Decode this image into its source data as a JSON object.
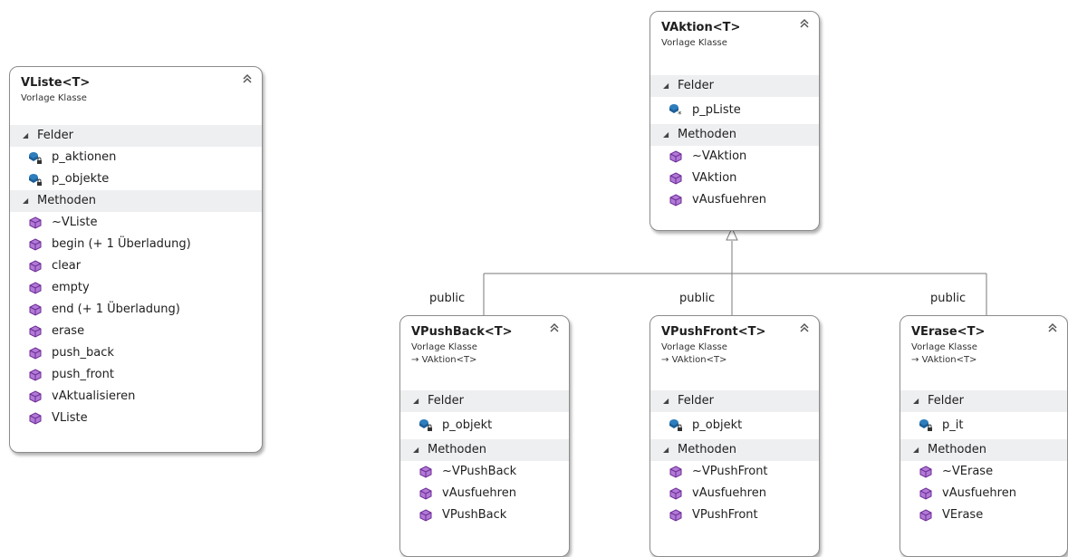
{
  "diagram": {
    "classes": {
      "vliste": {
        "title": "VListe<T>",
        "stereotype": "Vorlage Klasse",
        "fields_header": "Felder",
        "fields": [
          "p_aktionen",
          "p_objekte"
        ],
        "methods_header": "Methoden",
        "methods": [
          "~VListe",
          "begin (+ 1 Überladung)",
          "clear",
          "empty",
          "end (+ 1 Überladung)",
          "erase",
          "push_back",
          "push_front",
          "vAktualisieren",
          "VListe"
        ]
      },
      "vaktion": {
        "title": "VAktion<T>",
        "stereotype": "Vorlage Klasse",
        "fields_header": "Felder",
        "fields": [
          "p_pListe"
        ],
        "methods_header": "Methoden",
        "methods": [
          "~VAktion",
          "VAktion",
          "vAusfuehren"
        ]
      },
      "vpushback": {
        "title": "VPushBack<T>",
        "stereotype": "Vorlage Klasse",
        "inherits": "VAktion<T>",
        "fields_header": "Felder",
        "fields": [
          "p_objekt"
        ],
        "methods_header": "Methoden",
        "methods": [
          "~VPushBack",
          "vAusfuehren",
          "VPushBack"
        ]
      },
      "vpushfront": {
        "title": "VPushFront<T>",
        "stereotype": "Vorlage Klasse",
        "inherits": "VAktion<T>",
        "fields_header": "Felder",
        "fields": [
          "p_objekt"
        ],
        "methods_header": "Methoden",
        "methods": [
          "~VPushFront",
          "vAusfuehren",
          "VPushFront"
        ]
      },
      "verase": {
        "title": "VErase<T>",
        "stereotype": "Vorlage Klasse",
        "inherits": "VAktion<T>",
        "fields_header": "Felder",
        "fields": [
          "p_it"
        ],
        "methods_header": "Methoden",
        "methods": [
          "~VErase",
          "vAusfuehren",
          "VErase"
        ]
      }
    },
    "connectors": {
      "pushback_label": "public",
      "pushfront_label": "public",
      "erase_label": "public"
    },
    "icons": {
      "field_private": "field-private-lock-icon",
      "field_protected": "field-protected-star-icon",
      "method": "method-cube-icon",
      "collapse": "double-chevron-up-icon",
      "inherit_arrow": "inherit-arrow-icon"
    },
    "colors": {
      "field_icon": "#2e7dbd",
      "method_icon": "#8a3fb5",
      "section_bg": "#eeeff1",
      "border": "#8c8c8c"
    }
  }
}
